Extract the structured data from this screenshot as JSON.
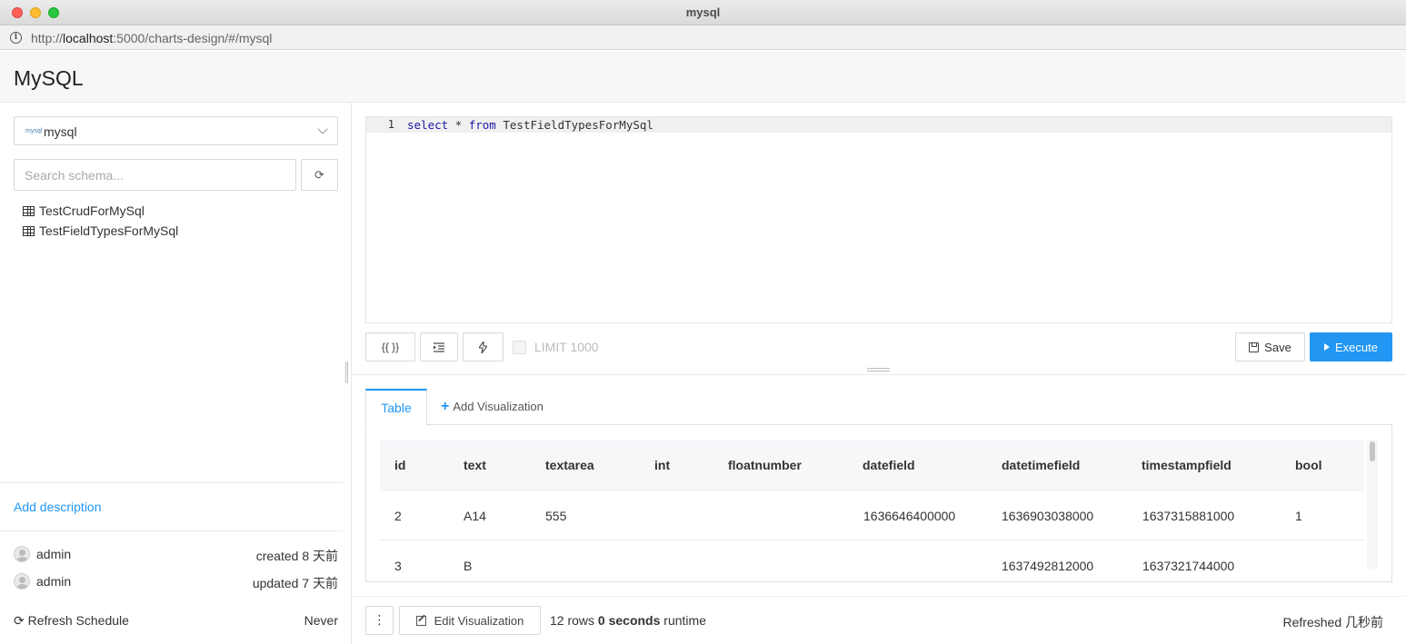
{
  "window": {
    "title": "mysql"
  },
  "address_bar": {
    "url_prefix": "http://",
    "url_host": "localhost",
    "url_rest": ":5000/charts-design/#/mysql"
  },
  "header": {
    "title": "MySQL"
  },
  "sidebar": {
    "datasource": {
      "logo": "mysql",
      "label": "mysql"
    },
    "search": {
      "placeholder": "Search schema..."
    },
    "schema_items": [
      "TestCrudForMySql",
      "TestFieldTypesForMySql"
    ],
    "add_description": "Add description",
    "created": {
      "user": "admin",
      "label": "created 8 天前"
    },
    "updated": {
      "user": "admin",
      "label": "updated 7 天前"
    },
    "refresh_schedule": {
      "label": "Refresh Schedule",
      "value": "Never"
    }
  },
  "editor": {
    "line_number": "1",
    "tokens": {
      "select": "select",
      "star": " * ",
      "from": "from",
      "table": " TestFieldTypesForMySql"
    }
  },
  "toolbar": {
    "params_label": "{{ }}",
    "limit_label": "LIMIT 1000",
    "save_label": "Save",
    "execute_label": "Execute"
  },
  "tabs": {
    "table": "Table",
    "add_visualization": "Add Visualization"
  },
  "results": {
    "columns": [
      "id",
      "text",
      "textarea",
      "int",
      "floatnumber",
      "datefield",
      "datetimefield",
      "timestampfield",
      "bool"
    ],
    "rows": [
      [
        "2",
        "A14",
        "555",
        "",
        "",
        "1636646400000",
        "1636903038000",
        "1637315881000",
        "1"
      ],
      [
        "3",
        "B",
        "",
        "",
        "",
        "",
        "1637492812000",
        "1637321744000",
        ""
      ]
    ]
  },
  "footer": {
    "kebab": "⋮",
    "edit_visualization": "Edit Visualization",
    "rows_count": "12 rows",
    "runtime_value": "0 seconds",
    "runtime_label": " runtime",
    "refreshed_label": "Refreshed 几秒前"
  },
  "colors": {
    "accent": "#2196f3",
    "header_bg": "#f6f7f9",
    "border": "#d9d9d9"
  }
}
